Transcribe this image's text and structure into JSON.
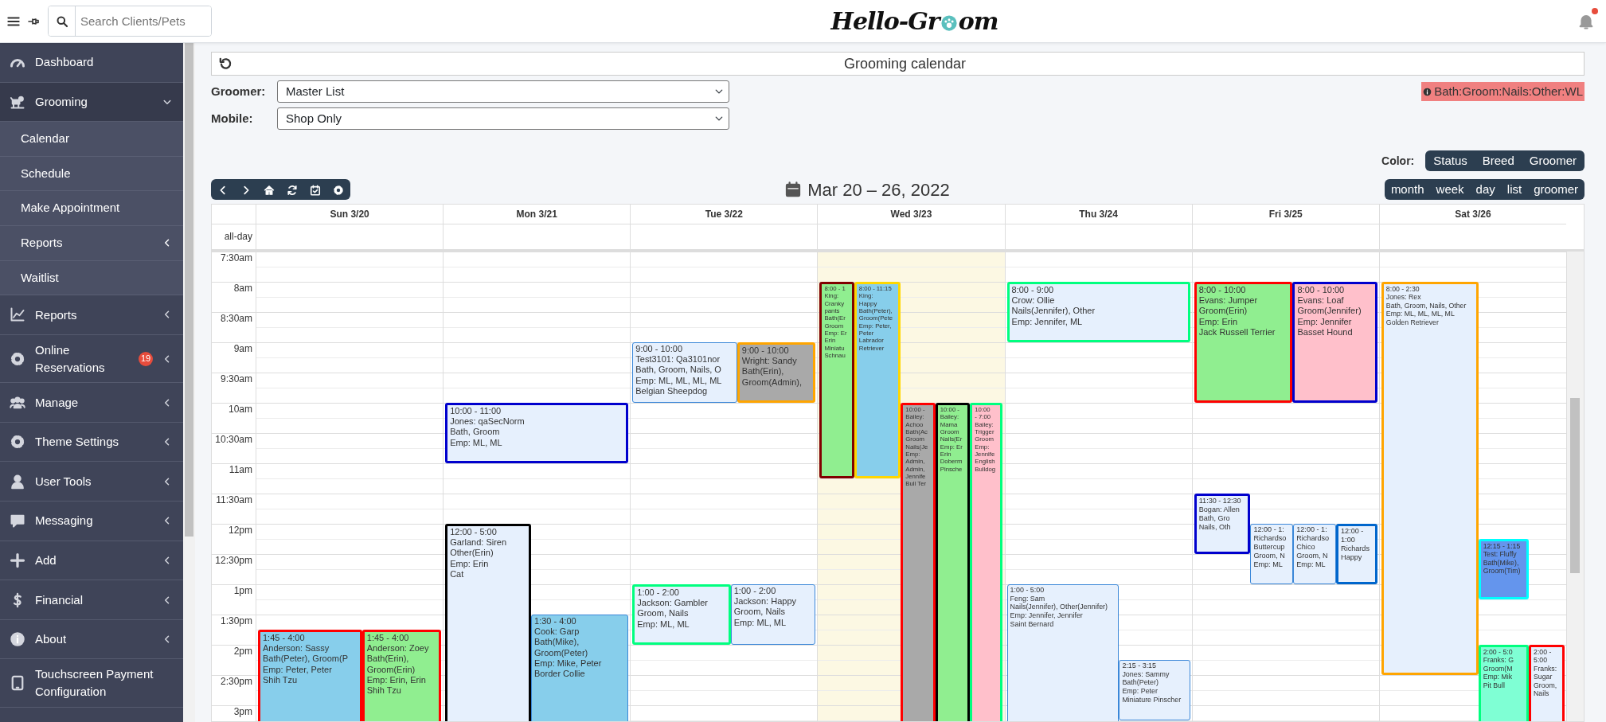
{
  "topbar": {
    "search_placeholder": "Search Clients/Pets",
    "logo_start": "Hello-Gr",
    "logo_end": "om"
  },
  "sidebar": {
    "items": [
      {
        "label": "Dashboard"
      },
      {
        "label": "Grooming",
        "expanded": true,
        "children": [
          {
            "label": "Calendar"
          },
          {
            "label": "Schedule"
          },
          {
            "label": "Make Appointment"
          },
          {
            "label": "Reports",
            "expanded": false
          },
          {
            "label": "Waitlist"
          }
        ]
      },
      {
        "label": "Reports",
        "expanded": false
      },
      {
        "label": "Online Reservations",
        "badge": "19",
        "expanded": false
      },
      {
        "label": "Manage",
        "expanded": false
      },
      {
        "label": "Theme Settings",
        "expanded": false
      },
      {
        "label": "User Tools",
        "expanded": false
      },
      {
        "label": "Messaging",
        "expanded": false
      },
      {
        "label": "Add",
        "expanded": false
      },
      {
        "label": "Financial",
        "expanded": false
      },
      {
        "label": "About",
        "expanded": false
      },
      {
        "label": "Touchscreen Payment Configuration"
      }
    ]
  },
  "page_title": "Grooming calendar",
  "filters": [
    {
      "label": "Groomer:",
      "value": "Master List"
    },
    {
      "label": "Mobile:",
      "value": "Shop Only"
    }
  ],
  "legend": "Bath:Groom:Nails:Other:WL",
  "color_by": {
    "label": "Color:",
    "options": [
      "Status",
      "Breed",
      "Groomer"
    ]
  },
  "calendar": {
    "range_title": "Mar 20 – 26, 2022",
    "views": [
      "month",
      "week",
      "day",
      "list",
      "groomer"
    ],
    "all_day_label": "all-day",
    "times": [
      "7:30am",
      "8am",
      "8:30am",
      "9am",
      "9:30am",
      "10am",
      "10:30am",
      "11am",
      "11:30am",
      "12pm",
      "12:30pm",
      "1pm",
      "1:30pm",
      "2pm",
      "2:30pm",
      "3pm"
    ],
    "days": [
      {
        "label": "Sun 3/20",
        "today": false,
        "events": [
          {
            "kind": "flagged",
            "color": "#87ceeb",
            "border": {
              "color": "#ff0000"
            },
            "lines": [
              "1:45 - 4:00",
              "Anderson: Sassy",
              "Bath(Peter), Groom(P",
              "Emp: Peter, Peter",
              "Shih Tzu"
            ]
          },
          {
            "kind": "flagged",
            "color": "#90ee90",
            "border": {
              "color": "#ff0000"
            },
            "lines": [
              "1:45 - 4:00",
              "Anderson: Zoey",
              "Bath(Erin),",
              "Groom(Erin)",
              "Emp: Erin, Erin",
              "Shih Tzu"
            ]
          }
        ]
      },
      {
        "label": "Mon 3/21",
        "today": false,
        "events": [
          {
            "kind": "flagged",
            "color": "#e6f0fd",
            "border": {
              "color": "#0000cd"
            },
            "lines": [
              "10:00 - 11:00",
              "Jones: qaSecNorm",
              "Bath, Groom",
              "Emp: ML, ML"
            ]
          },
          {
            "kind": "flagged",
            "color": "#e6f0fd",
            "border": {
              "color": "#000000"
            },
            "lines": [
              "12:00 - 5:00",
              "Garland: Siren",
              "Other(Erin)",
              "Emp: Erin",
              "Cat"
            ]
          },
          {
            "kind": "plain",
            "color": "#87ceeb",
            "border": {
              "color": "#3a87d8"
            },
            "lines": [
              "1:30 - 4:00",
              "Cook: Garp",
              "Bath(Mike),",
              "Groom(Peter)",
              "Emp: Mike, Peter",
              "Border Collie"
            ]
          }
        ]
      },
      {
        "label": "Tue 3/22",
        "today": false,
        "events": [
          {
            "kind": "plain",
            "color": "#e6f0fd",
            "border": {
              "color": "#3a87d8"
            },
            "lines": [
              "9:00 - 10:00",
              "Test3101: Qa3101nor",
              "Bath, Groom, Nails, O",
              "Emp: ML, ML, ML, ML",
              "Belgian Sheepdog"
            ]
          },
          {
            "kind": "flagged",
            "color": "#a9a9a9",
            "border": {
              "color": "#ffa500"
            },
            "lines": [
              "9:00 - 10:00",
              "Wright: Sandy",
              "Bath(Erin),",
              "Groom(Admin),"
            ]
          },
          {
            "kind": "flagged",
            "color": "#e6f0fd",
            "border": {
              "color": "#00ff7f"
            },
            "lines": [
              "1:00 - 2:00",
              "Jackson: Gambler",
              "Groom, Nails",
              "Emp: ML, ML"
            ]
          },
          {
            "kind": "plain",
            "color": "#e6f0fd",
            "border": {
              "color": "#3a87d8"
            },
            "lines": [
              "1:00 - 2:00",
              "Jackson: Happy",
              "Groom, Nails",
              "Emp: ML, ML"
            ]
          }
        ]
      },
      {
        "label": "Wed 3/23",
        "today": true,
        "events": [
          {
            "kind": "flagged",
            "color": "#90ee90",
            "border": {
              "color": "#800000"
            },
            "lines": [
              "8:00 - 1",
              "King:",
              "Cranky",
              "pants",
              "Bath(Er",
              "Groom",
              "Emp: Er",
              "Erin",
              "Miniatu",
              "Schnau"
            ]
          },
          {
            "kind": "flagged",
            "color": "#87ceeb",
            "border": {
              "color": "#ffd700"
            },
            "lines": [
              "8:00 - 11:15",
              "King:",
              "Happy",
              "Bath(Peter),",
              "Groom(Pete",
              "Emp: Peter,",
              "Peter",
              "Labrador",
              "Retriever"
            ]
          },
          {
            "kind": "flagged",
            "color": "#a9a9a9",
            "border": {
              "color": "#ff0000"
            },
            "lines": [
              "10:00 -",
              "Bailey:",
              "Achoo",
              "Bath(Ac",
              "Groom",
              "Nails(Je",
              "Emp:",
              "Admin,",
              "Admin,",
              "Jennife",
              "Bull Ter"
            ]
          },
          {
            "kind": "flagged",
            "color": "#90ee90",
            "border": {
              "color": "#000000"
            },
            "lines": [
              "10:00 -",
              "Bailey:",
              "Mama",
              "Groom",
              "Nails(Er",
              "Emp: Er",
              "Erin",
              "Doberm",
              "Pinsche"
            ]
          },
          {
            "kind": "flagged",
            "color": "#ffc0cb",
            "border": {
              "color": "#00ff7f"
            },
            "lines": [
              "10:00",
              "- 7:00",
              "Bailey:",
              "Trigger",
              "Groom",
              "Emp:",
              "Jennife",
              "English",
              "Bulldog"
            ]
          }
        ]
      },
      {
        "label": "Thu 3/24",
        "today": false,
        "events": [
          {
            "kind": "flagged",
            "color": "#e6f0fd",
            "border": {
              "color": "#00ff7f"
            },
            "lines": [
              "8:00 - 9:00",
              "Crow: Ollie",
              "Nails(Jennifer), Other",
              "Emp: Jennifer, ML"
            ]
          },
          {
            "kind": "plain",
            "color": "#e6f0fd",
            "border": {
              "color": "#3a87d8"
            },
            "lines": [
              "1:00 - 5:00",
              "Feng: Sam",
              "Nails(Jennifer), Other(Jennifer)",
              "Emp: Jennifer, Jennifer",
              "Saint Bernard"
            ]
          },
          {
            "kind": "plain",
            "color": "#e6f0fd",
            "border": {
              "color": "#3a87d8"
            },
            "lines": [
              "2:15 - 3:15",
              "Jones: Sammy",
              "Bath(Peter)",
              "Emp: Peter",
              "Miniature Pinscher"
            ]
          }
        ]
      },
      {
        "label": "Fri 3/25",
        "today": false,
        "events": [
          {
            "kind": "flagged",
            "color": "#90ee90",
            "border": {
              "color": "#ff0000"
            },
            "lines": [
              "8:00 - 10:00",
              "Evans: Jumper",
              "Groom(Erin)",
              "Emp: Erin",
              "Jack Russell Terrier"
            ]
          },
          {
            "kind": "flagged",
            "color": "#ffc0cb",
            "border": {
              "color": "#0000cd"
            },
            "lines": [
              "8:00 - 10:00",
              "Evans: Loaf",
              "Groom(Jennifer)",
              "Emp: Jennifer",
              "Basset Hound"
            ]
          },
          {
            "kind": "flagged",
            "color": "#e6f0fd",
            "border": {
              "color": "#0000cd"
            },
            "lines": [
              "11:30 - 12:30",
              "Bogan: Allen",
              "Bath, Gro",
              "Nails, Oth"
            ]
          },
          {
            "kind": "plain",
            "color": "#e6f0fd",
            "border": {
              "color": "#3a87d8"
            },
            "lines": [
              "12:00 - 1:",
              "Richardso",
              "Buttercup",
              "Groom, N",
              "Emp: ML"
            ]
          },
          {
            "kind": "plain",
            "color": "#e6f0fd",
            "border": {
              "color": "#3a87d8"
            },
            "lines": [
              "12:00 - 1:",
              "Richardso",
              "Chico",
              "Groom, N",
              "Emp: ML"
            ]
          },
          {
            "kind": "flagged",
            "color": "#e6f0fd",
            "border": {
              "color": "#0066cc"
            },
            "lines": [
              "12:00 -",
              "1:00",
              "Richards",
              "Happy"
            ]
          }
        ]
      },
      {
        "label": "Sat 3/26",
        "today": false,
        "events": [
          {
            "kind": "flagged",
            "color": "#e6f0fd",
            "border": {
              "color": "#ffa500"
            },
            "lines": [
              "8:00 - 2:30",
              "Jones: Rex",
              "Bath, Groom, Nails, Other",
              "Emp: ML, ML, ML, ML",
              "Golden Retriever"
            ]
          },
          {
            "kind": "flagged",
            "color": "#6495ed",
            "border": {
              "color": "#00ffff"
            },
            "lines": [
              "12:15 - 1:15",
              "Test: Fluffy",
              "Bath(Mike),",
              "Groom(Tim)"
            ]
          },
          {
            "kind": "flagged",
            "color": "#7fffd4",
            "border": {
              "color": "#00ff7f"
            },
            "lines": [
              "2:00 - 5:0",
              "Franks: G",
              "Groom(M",
              "Emp: Mik",
              "Pit Bull"
            ]
          },
          {
            "kind": "flagged",
            "color": "#e6f0fd",
            "border": {
              "color": "#ff0000"
            },
            "lines": [
              "2:00 -",
              "5:00",
              "Franks:",
              "Sugar",
              "Groom,",
              "Nails"
            ]
          }
        ]
      }
    ]
  }
}
